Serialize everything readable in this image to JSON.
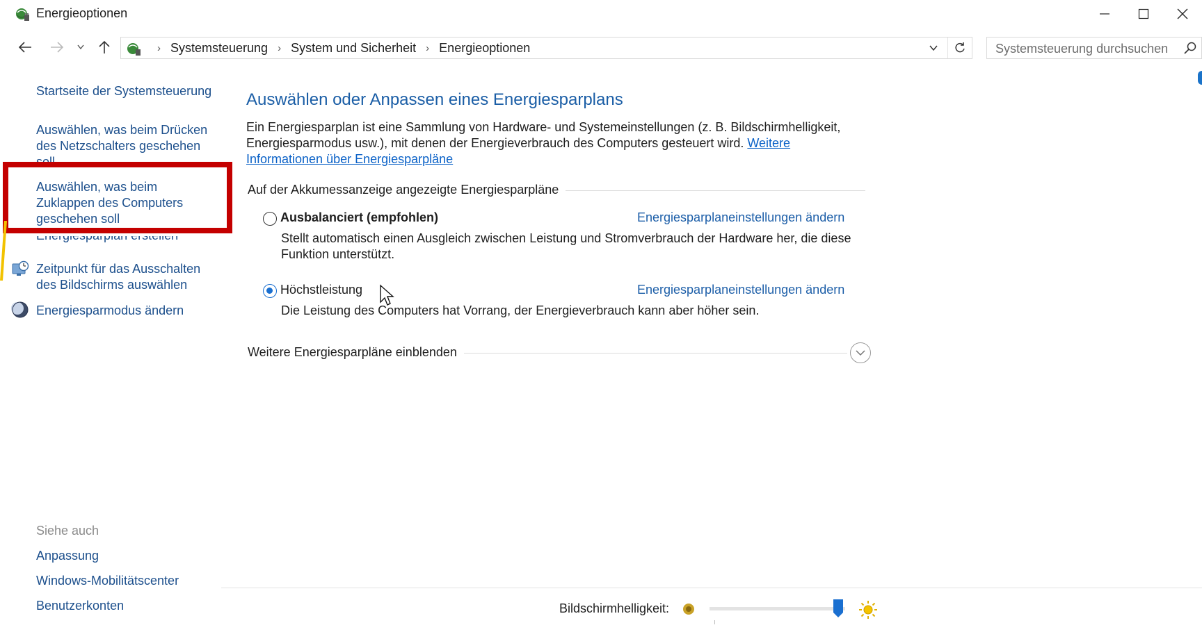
{
  "window": {
    "title": "Energieoptionen",
    "minimize_icon": "minimize-icon",
    "maximize_icon": "maximize-icon",
    "close_icon": "close-icon"
  },
  "address": {
    "breadcrumbs": [
      "Systemsteuerung",
      "System und Sicherheit",
      "Energieoptionen"
    ],
    "separator": "›",
    "search_placeholder": "Systemsteuerung durchsuchen"
  },
  "sidebar": {
    "items": [
      {
        "label": "Startseite der Systemsteuerung"
      },
      {
        "label": "Auswählen, was beim Drücken des Netzschalters geschehen soll"
      },
      {
        "label": "Auswählen, was beim Zuklappen des Computers geschehen soll"
      },
      {
        "label": "Energiesparplan erstellen"
      },
      {
        "label": "Zeitpunkt für das Ausschalten des Bildschirms auswählen",
        "icon": "monitor-clock-icon"
      },
      {
        "label": "Energiesparmodus ändern",
        "icon": "moon-icon"
      }
    ],
    "see_also": {
      "title": "Siehe auch",
      "links": [
        "Anpassung",
        "Windows-Mobilitätscenter",
        "Benutzerkonten"
      ]
    }
  },
  "main": {
    "heading": "Auswählen oder Anpassen eines Energiesparplans",
    "intro": "Ein Energiesparplan ist eine Sammlung von Hardware- und Systemeinstellungen (z. B. Bildschirmhelligkeit, Energiesparmodus usw.), mit denen der Energieverbrauch des Computers gesteuert wird.",
    "intro_link": "Weitere Informationen über Energiesparpläne",
    "group_label": "Auf der Akkumessanzeige angezeigte Energiesparpläne",
    "plans": [
      {
        "name": "Ausbalanciert (empfohlen)",
        "selected": false,
        "link": "Energiesparplaneinstellungen ändern",
        "description": "Stellt automatisch einen Ausgleich zwischen Leistung und Stromverbrauch der Hardware her, die diese Funktion unterstützt."
      },
      {
        "name": "Höchstleistung",
        "selected": true,
        "link": "Energiesparplaneinstellungen ändern",
        "description": "Die Leistung des Computers hat Vorrang, der Energieverbrauch kann aber höher sein."
      }
    ],
    "more_plans_label": "Weitere Energiesparpläne einblenden"
  },
  "brightness": {
    "label": "Bildschirmhelligkeit:",
    "level_fraction": 0.95
  },
  "colors": {
    "link": "#1c4f8c",
    "heading": "#1b5ea6",
    "highlight_box": "#c40000",
    "radio_selected": "#1a6fd0"
  }
}
